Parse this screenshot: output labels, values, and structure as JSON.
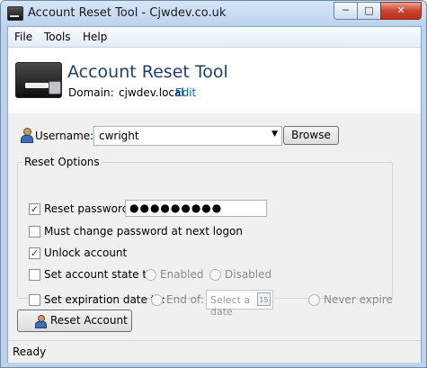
{
  "window": {
    "title": "Account Reset Tool - Cjwdev.co.uk",
    "min_glyph": "─",
    "max_glyph": "□",
    "close_glyph": "✕"
  },
  "menu": {
    "items": [
      "File",
      "Tools",
      "Help"
    ]
  },
  "header": {
    "title": "Account Reset Tool",
    "domain_label": "Domain:",
    "domain_value": "cjwdev.local",
    "edit_link": "Edit"
  },
  "username": {
    "label": "Username:",
    "value": "cwright",
    "arrow": "▼",
    "browse_label": "Browse"
  },
  "options": {
    "legend": "Reset Options",
    "reset_password": {
      "label": "Reset password:",
      "checked": "✓",
      "password_mask": "●●●●●●●●●"
    },
    "must_change": {
      "label": "Must change password at next logon",
      "checked": ""
    },
    "unlock": {
      "label": "Unlock account",
      "checked": "✓"
    },
    "account_state": {
      "label": "Set account state to:",
      "checked": "",
      "enabled_label": "Enabled",
      "disabled_label": "Disabled"
    },
    "expiration": {
      "label": "Set expiration date to:",
      "checked": "",
      "end_of_label": "End of:",
      "date_placeholder": "Select a date",
      "calendar_day": "15",
      "never_label": "Never expire"
    }
  },
  "actions": {
    "reset_label": "Reset Account"
  },
  "status": {
    "text": "Ready"
  },
  "colors": {
    "accent": "#1e3f72",
    "link": "#0066cc",
    "close_button": "#c7452d"
  }
}
